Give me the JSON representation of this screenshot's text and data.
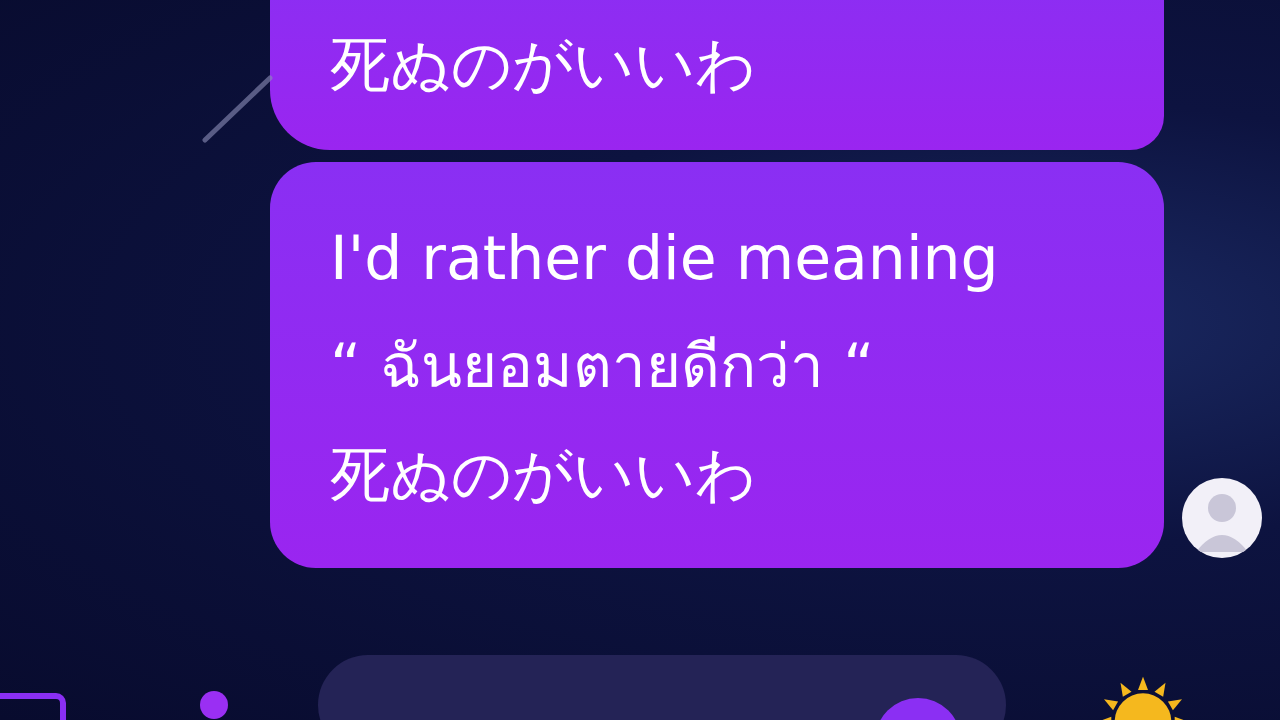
{
  "messages": [
    {
      "lines": [
        "死ぬのがいいわ"
      ],
      "avatar": false
    },
    {
      "lines": [
        "I'd rather die meaning",
        "“ ฉันยอมตายดีกว่า “",
        "死ぬのがいいわ"
      ],
      "avatar": true
    }
  ]
}
